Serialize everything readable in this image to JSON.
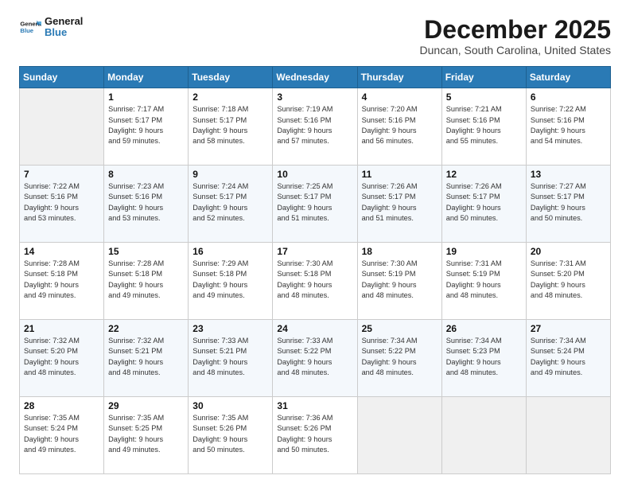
{
  "logo": {
    "general": "General",
    "blue": "Blue"
  },
  "header": {
    "month": "December 2025",
    "location": "Duncan, South Carolina, United States"
  },
  "weekdays": [
    "Sunday",
    "Monday",
    "Tuesday",
    "Wednesday",
    "Thursday",
    "Friday",
    "Saturday"
  ],
  "weeks": [
    [
      {
        "day": "",
        "info": ""
      },
      {
        "day": "1",
        "info": "Sunrise: 7:17 AM\nSunset: 5:17 PM\nDaylight: 9 hours\nand 59 minutes."
      },
      {
        "day": "2",
        "info": "Sunrise: 7:18 AM\nSunset: 5:17 PM\nDaylight: 9 hours\nand 58 minutes."
      },
      {
        "day": "3",
        "info": "Sunrise: 7:19 AM\nSunset: 5:16 PM\nDaylight: 9 hours\nand 57 minutes."
      },
      {
        "day": "4",
        "info": "Sunrise: 7:20 AM\nSunset: 5:16 PM\nDaylight: 9 hours\nand 56 minutes."
      },
      {
        "day": "5",
        "info": "Sunrise: 7:21 AM\nSunset: 5:16 PM\nDaylight: 9 hours\nand 55 minutes."
      },
      {
        "day": "6",
        "info": "Sunrise: 7:22 AM\nSunset: 5:16 PM\nDaylight: 9 hours\nand 54 minutes."
      }
    ],
    [
      {
        "day": "7",
        "info": "Sunrise: 7:22 AM\nSunset: 5:16 PM\nDaylight: 9 hours\nand 53 minutes."
      },
      {
        "day": "8",
        "info": "Sunrise: 7:23 AM\nSunset: 5:16 PM\nDaylight: 9 hours\nand 53 minutes."
      },
      {
        "day": "9",
        "info": "Sunrise: 7:24 AM\nSunset: 5:17 PM\nDaylight: 9 hours\nand 52 minutes."
      },
      {
        "day": "10",
        "info": "Sunrise: 7:25 AM\nSunset: 5:17 PM\nDaylight: 9 hours\nand 51 minutes."
      },
      {
        "day": "11",
        "info": "Sunrise: 7:26 AM\nSunset: 5:17 PM\nDaylight: 9 hours\nand 51 minutes."
      },
      {
        "day": "12",
        "info": "Sunrise: 7:26 AM\nSunset: 5:17 PM\nDaylight: 9 hours\nand 50 minutes."
      },
      {
        "day": "13",
        "info": "Sunrise: 7:27 AM\nSunset: 5:17 PM\nDaylight: 9 hours\nand 50 minutes."
      }
    ],
    [
      {
        "day": "14",
        "info": "Sunrise: 7:28 AM\nSunset: 5:18 PM\nDaylight: 9 hours\nand 49 minutes."
      },
      {
        "day": "15",
        "info": "Sunrise: 7:28 AM\nSunset: 5:18 PM\nDaylight: 9 hours\nand 49 minutes."
      },
      {
        "day": "16",
        "info": "Sunrise: 7:29 AM\nSunset: 5:18 PM\nDaylight: 9 hours\nand 49 minutes."
      },
      {
        "day": "17",
        "info": "Sunrise: 7:30 AM\nSunset: 5:18 PM\nDaylight: 9 hours\nand 48 minutes."
      },
      {
        "day": "18",
        "info": "Sunrise: 7:30 AM\nSunset: 5:19 PM\nDaylight: 9 hours\nand 48 minutes."
      },
      {
        "day": "19",
        "info": "Sunrise: 7:31 AM\nSunset: 5:19 PM\nDaylight: 9 hours\nand 48 minutes."
      },
      {
        "day": "20",
        "info": "Sunrise: 7:31 AM\nSunset: 5:20 PM\nDaylight: 9 hours\nand 48 minutes."
      }
    ],
    [
      {
        "day": "21",
        "info": "Sunrise: 7:32 AM\nSunset: 5:20 PM\nDaylight: 9 hours\nand 48 minutes."
      },
      {
        "day": "22",
        "info": "Sunrise: 7:32 AM\nSunset: 5:21 PM\nDaylight: 9 hours\nand 48 minutes."
      },
      {
        "day": "23",
        "info": "Sunrise: 7:33 AM\nSunset: 5:21 PM\nDaylight: 9 hours\nand 48 minutes."
      },
      {
        "day": "24",
        "info": "Sunrise: 7:33 AM\nSunset: 5:22 PM\nDaylight: 9 hours\nand 48 minutes."
      },
      {
        "day": "25",
        "info": "Sunrise: 7:34 AM\nSunset: 5:22 PM\nDaylight: 9 hours\nand 48 minutes."
      },
      {
        "day": "26",
        "info": "Sunrise: 7:34 AM\nSunset: 5:23 PM\nDaylight: 9 hours\nand 48 minutes."
      },
      {
        "day": "27",
        "info": "Sunrise: 7:34 AM\nSunset: 5:24 PM\nDaylight: 9 hours\nand 49 minutes."
      }
    ],
    [
      {
        "day": "28",
        "info": "Sunrise: 7:35 AM\nSunset: 5:24 PM\nDaylight: 9 hours\nand 49 minutes."
      },
      {
        "day": "29",
        "info": "Sunrise: 7:35 AM\nSunset: 5:25 PM\nDaylight: 9 hours\nand 49 minutes."
      },
      {
        "day": "30",
        "info": "Sunrise: 7:35 AM\nSunset: 5:26 PM\nDaylight: 9 hours\nand 50 minutes."
      },
      {
        "day": "31",
        "info": "Sunrise: 7:36 AM\nSunset: 5:26 PM\nDaylight: 9 hours\nand 50 minutes."
      },
      {
        "day": "",
        "info": ""
      },
      {
        "day": "",
        "info": ""
      },
      {
        "day": "",
        "info": ""
      }
    ]
  ]
}
